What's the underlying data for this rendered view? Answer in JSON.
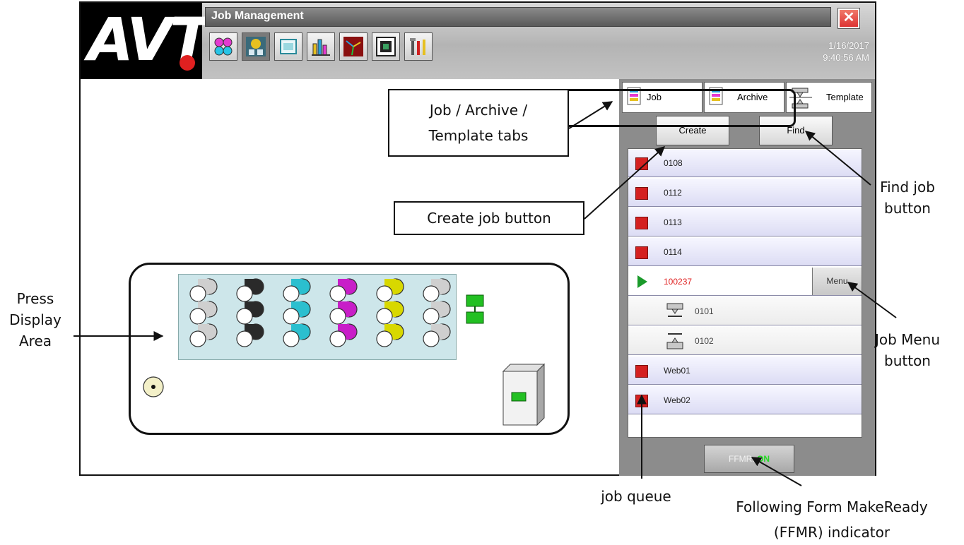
{
  "window": {
    "logo_text": "AVT",
    "title": "Job Management",
    "close_icon": "close-icon",
    "date": "1/16/2017",
    "time": "9:40:56 AM"
  },
  "toolbar": {
    "icons": [
      "color-registration-icon",
      "job-management-icon",
      "inspection-icon",
      "reports-icon",
      "density-icon",
      "layout-icon",
      "tools-icon"
    ]
  },
  "tabs": [
    {
      "label": "Job",
      "icon": "job-list-icon"
    },
    {
      "label": "Archive",
      "icon": "archive-list-icon"
    },
    {
      "label": "Template",
      "icon": "template-icon"
    }
  ],
  "actions": {
    "create_label": "Create",
    "find_label": "Find"
  },
  "queue": [
    {
      "name": "0108",
      "state": "queued"
    },
    {
      "name": "0112",
      "state": "queued"
    },
    {
      "name": "0113",
      "state": "queued"
    },
    {
      "name": "0114",
      "state": "queued"
    },
    {
      "name": "100237",
      "state": "active"
    },
    {
      "name": "0101",
      "state": "form"
    },
    {
      "name": "0102",
      "state": "form"
    },
    {
      "name": "Web01",
      "state": "queued"
    },
    {
      "name": "Web02",
      "state": "queued"
    }
  ],
  "menu_label": "Menu",
  "ffmr": {
    "label": "FFMR:",
    "status": "ON"
  },
  "press": {
    "units": [
      "#cfcfcf",
      "#2a2a2a",
      "#2bbfcf",
      "#c81ec8",
      "#d8d800",
      "#cfcfcf"
    ]
  },
  "callouts": {
    "tabs": [
      "Job / Archive /",
      "Template tabs"
    ],
    "create": "Create job button",
    "find": [
      "Find job",
      "button"
    ],
    "menu": [
      "Job Menu",
      "button"
    ],
    "press": [
      "Press",
      "Display",
      "Area"
    ],
    "queue": "job queue",
    "ffmr": [
      "Following Form MakeReady",
      "(FFMR) indicator"
    ]
  }
}
